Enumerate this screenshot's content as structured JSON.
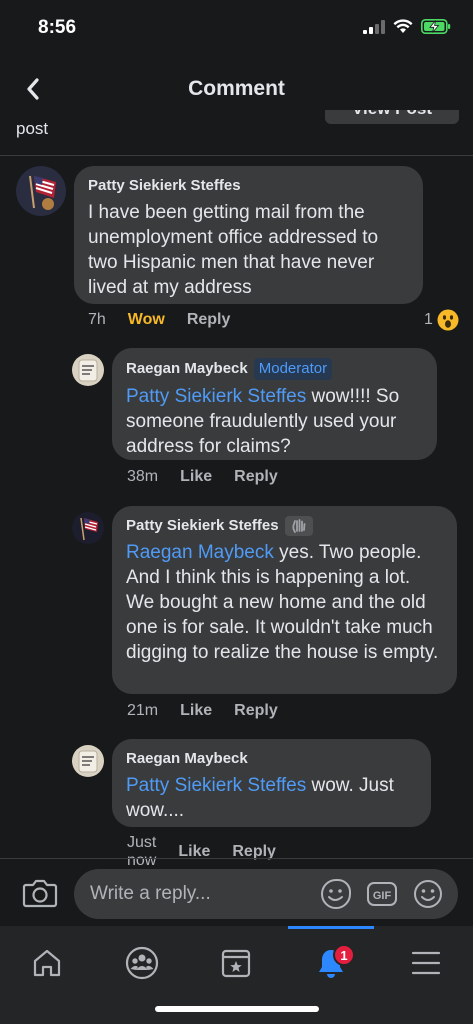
{
  "status": {
    "time": "8:56"
  },
  "header": {
    "title": "Comment"
  },
  "post_strip": {
    "label": "post",
    "view_post": "View Post"
  },
  "comments": [
    {
      "author": "Patty Siekierk Steffes",
      "text": "I have been getting mail from the unemployment office addressed to two Hispanic men that have never lived at my address",
      "time": "7h",
      "reaction_label": "Wow",
      "reply_label": "Reply",
      "reaction_count": "1"
    },
    {
      "author": "Raegan Maybeck",
      "badge": "Moderator",
      "mention": "Patty Siekierk Steffes",
      "text": " wow!!!! So someone fraudulently used your address for claims?",
      "time": "38m",
      "like_label": "Like",
      "reply_label": "Reply"
    },
    {
      "author": "Patty Siekierk Steffes",
      "mention": "Raegan Maybeck",
      "text": " yes. Two people. And I think this is happening a lot. We bought a new home and the old one is for sale. It wouldn't take much digging to realize the house is empty.",
      "time": "21m",
      "like_label": "Like",
      "reply_label": "Reply"
    },
    {
      "author": "Raegan Maybeck",
      "mention": "Patty Siekierk Steffes",
      "text": " wow. Just wow....",
      "time": "Just now",
      "like_label": "Like",
      "reply_label": "Reply"
    }
  ],
  "reply_bar": {
    "placeholder": "Write a reply...",
    "gif_label": "GIF"
  },
  "tabbar": {
    "notification_count": "1"
  },
  "colors": {
    "background": "#18191a",
    "bubble": "#3a3b3c",
    "mention": "#4f9bf7",
    "wow": "#f7b928",
    "accent": "#2d88ff",
    "badge_red": "#e41e3f"
  }
}
